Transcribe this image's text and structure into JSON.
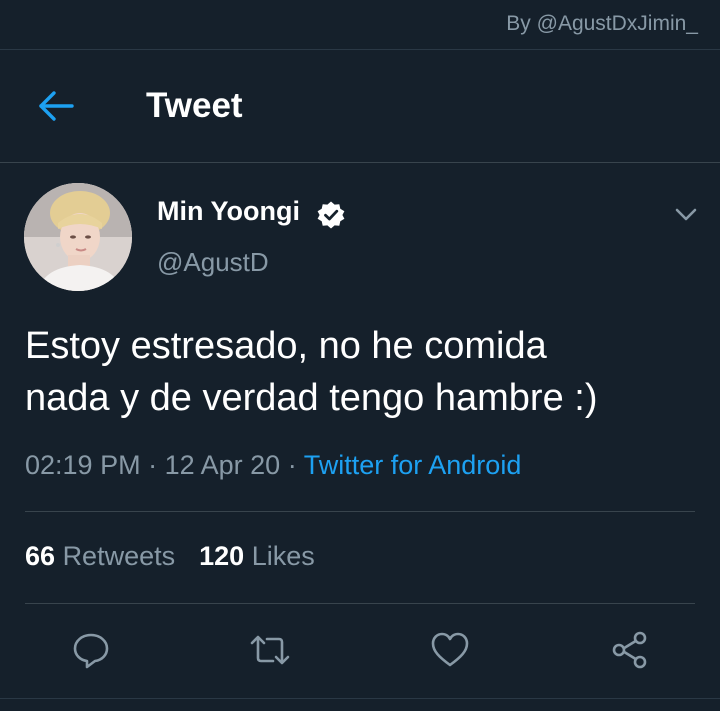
{
  "watermark": "By @AgustDxJimin_",
  "header": {
    "title": "Tweet",
    "back_icon": "arrow-left-icon"
  },
  "tweet": {
    "author": {
      "name": "Min Yoongi",
      "handle": "@AgustD",
      "verified": true
    },
    "text_lines": [
      "Estoy estresado, no he comida",
      "nada y de verdad tengo hambre :)"
    ],
    "time": "02:19 PM",
    "separator": "·",
    "date": "12 Apr 20",
    "source": "Twitter for Android",
    "stats": {
      "retweets_count": "66",
      "retweets_label": "Retweets",
      "likes_count": "120",
      "likes_label": "Likes"
    },
    "actions": [
      "reply-icon",
      "retweet-icon",
      "like-icon",
      "share-icon"
    ]
  },
  "colors": {
    "background": "#15202b",
    "text_primary": "#ffffff",
    "text_secondary": "#8899a6",
    "accent": "#1da1f2",
    "divider": "#38444d"
  }
}
